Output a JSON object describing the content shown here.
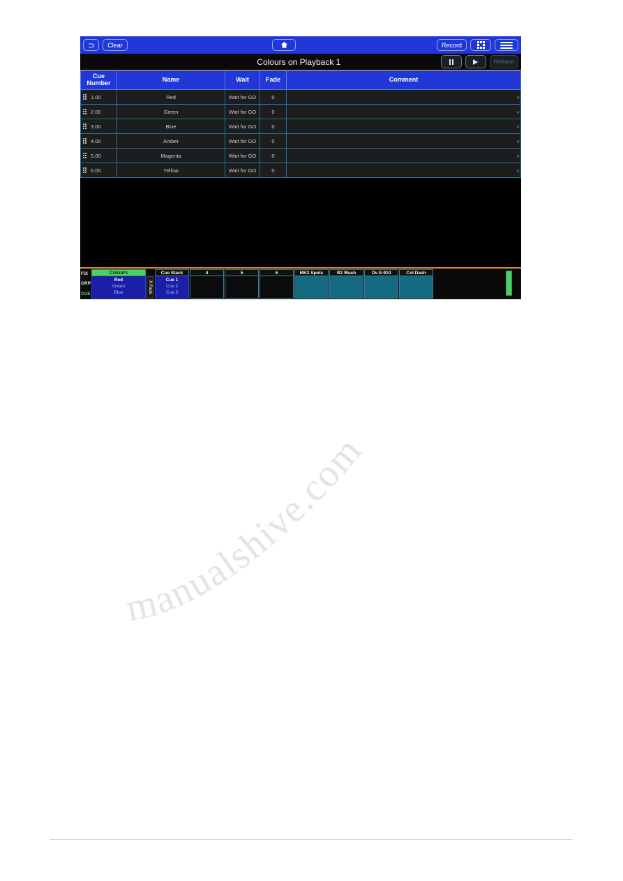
{
  "toolbar": {
    "back_icon": "undo-icon",
    "clear_label": "Clear",
    "home_icon": "home-icon",
    "record_label": "Record",
    "grid_icon": "grid-icon",
    "menu_icon": "hamburger-menu-icon"
  },
  "titlebar": {
    "title": "Colours on Playback 1",
    "pause_icon": "pause-icon",
    "play_icon": "play-icon",
    "release_label": "Release"
  },
  "table": {
    "headers": {
      "cue_number": "Cue Number",
      "name": "Name",
      "wait": "Wait",
      "fade": "Fade",
      "comment": "Comment"
    },
    "rows": [
      {
        "cue_number": "1.00",
        "name": "Red",
        "wait": "Wait for GO",
        "fade": "0",
        "comment": "",
        "selected": true
      },
      {
        "cue_number": "2.00",
        "name": "Green",
        "wait": "Wait for GO",
        "fade": "0",
        "comment": "",
        "selected": false
      },
      {
        "cue_number": "3.00",
        "name": "Blue",
        "wait": "Wait for GO",
        "fade": "0",
        "comment": "",
        "selected": false
      },
      {
        "cue_number": "4.00",
        "name": "Amber",
        "wait": "Wait for GO",
        "fade": "0",
        "comment": "",
        "selected": false
      },
      {
        "cue_number": "5.00",
        "name": "Magenta",
        "wait": "Wait for GO",
        "fade": "0",
        "comment": "",
        "selected": false
      },
      {
        "cue_number": "6.00",
        "name": "Yellow",
        "wait": "Wait for GO",
        "fade": "0",
        "comment": "",
        "selected": false
      }
    ],
    "row_action_icon": "chevron-double-left-icon"
  },
  "bottombar": {
    "side_tabs": [
      {
        "label": "FIX",
        "active": false
      },
      {
        "label": "GRP",
        "active": false
      },
      {
        "label": "CUE",
        "active": true
      }
    ],
    "palette": {
      "title": "Colours",
      "items": [
        {
          "label": "Red",
          "current": true
        },
        {
          "label": "Green",
          "current": false
        },
        {
          "label": "Blue",
          "current": false
        }
      ]
    },
    "xfade_label": "X Fade",
    "playbacks": [
      {
        "title": "Cue Stack",
        "style": "cuestack",
        "items": [
          {
            "label": "Cue 1",
            "current": true
          },
          {
            "label": "Cue 2",
            "current": false
          },
          {
            "label": "Cue 3",
            "current": false
          }
        ]
      },
      {
        "title": "4",
        "style": "empty",
        "items": []
      },
      {
        "title": "5",
        "style": "empty",
        "items": []
      },
      {
        "title": "6",
        "style": "empty",
        "items": []
      },
      {
        "title": "MK2 Spots",
        "style": "teal",
        "items": []
      },
      {
        "title": "R2 Wash",
        "style": "teal",
        "items": []
      },
      {
        "title": "Ov E-910",
        "style": "teal",
        "items": []
      },
      {
        "title": "Col Dash",
        "style": "teal",
        "items": []
      }
    ],
    "fader_name": "master-fader"
  },
  "colors": {
    "toolbar_blue": "#2237d8",
    "accent_orange": "#e08a28",
    "grid_line": "#1f6f96",
    "selection_blue": "#2f6df0",
    "palette_green": "#4fcf6a",
    "playback_teal": "#146a80"
  },
  "watermark": {
    "text": "manualshive.com"
  }
}
